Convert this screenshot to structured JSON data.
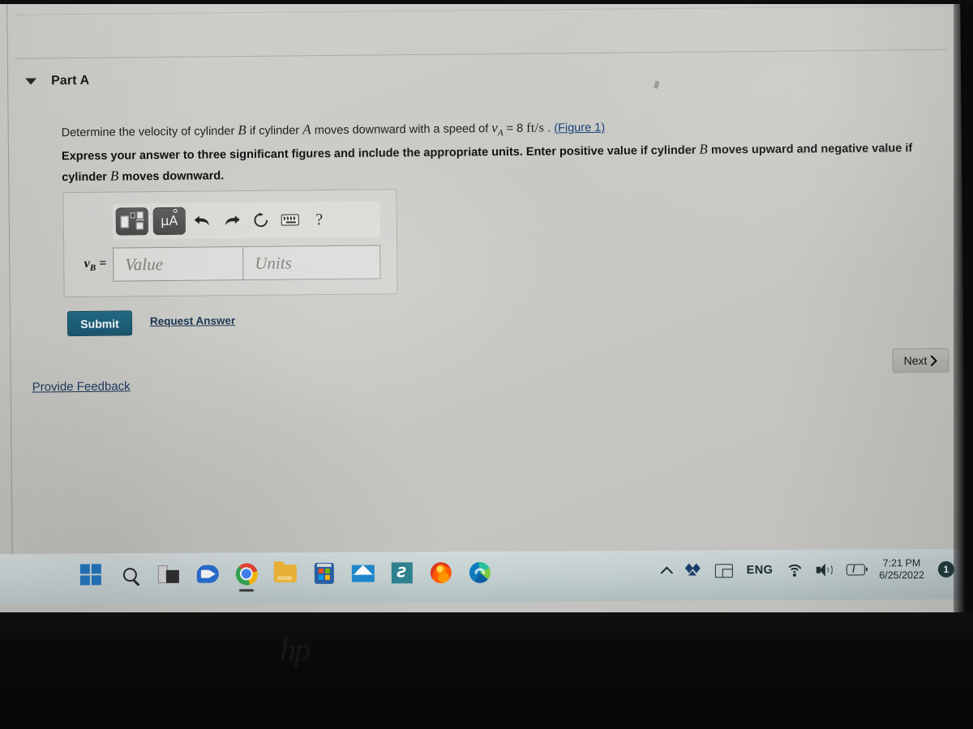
{
  "part": {
    "toggle_icon": "caret-down-icon",
    "title": "Part A"
  },
  "question": {
    "line1_a": "Determine the velocity of cylinder ",
    "line1_b": "B",
    "line1_c": " if cylinder ",
    "line1_d": "A",
    "line1_e": " moves downward with a speed of ",
    "line1_var": "v",
    "line1_sub": "A",
    "line1_eq": " = 8",
    "line1_units": "ft/s",
    "line1_period": ".",
    "figure_link": "(Figure 1)",
    "line2_a": "Express your answer to three significant figures and include the appropriate units. Enter positive value if cylinder ",
    "line2_b": "B",
    "line2_c": " moves upward and negative value if cylinder ",
    "line2_d": "B",
    "line2_e": " moves downward."
  },
  "answer_widget": {
    "toolbar": [
      {
        "name": "math-template-button",
        "label": "template"
      },
      {
        "name": "units-button",
        "label": "μA"
      },
      {
        "name": "undo-button",
        "label": "undo"
      },
      {
        "name": "redo-button",
        "label": "redo"
      },
      {
        "name": "reset-button",
        "label": "reset"
      },
      {
        "name": "keyboard-button",
        "label": "keyboard"
      },
      {
        "name": "help-button",
        "label": "?"
      }
    ],
    "help_glyph": "?",
    "unit_glyph": "μA",
    "variable": "v",
    "variable_sub": "B",
    "equals": "=",
    "value_placeholder": "Value",
    "units_placeholder": "Units",
    "value": "",
    "units": ""
  },
  "actions": {
    "submit_label": "Submit",
    "request_answer_label": "Request Answer",
    "next_label": "Next",
    "next_chevron": "›",
    "feedback_label": "Provide Feedback"
  },
  "colors": {
    "submit_bg": "#1b5670",
    "link": "#16324f",
    "figure_link": "#16417a",
    "page_bg": "#c7c7c3",
    "taskbar_bg": "#c6d2d3"
  },
  "taskbar": {
    "icons": [
      {
        "name": "start-button",
        "label": "Start"
      },
      {
        "name": "search-icon",
        "label": "Search"
      },
      {
        "name": "task-view-icon",
        "label": "Task View"
      },
      {
        "name": "meet-icon",
        "label": "Meet"
      },
      {
        "name": "chrome-icon",
        "label": "Google Chrome"
      },
      {
        "name": "file-explorer-icon",
        "label": "File Explorer"
      },
      {
        "name": "microsoft-store-icon",
        "label": "Microsoft Store"
      },
      {
        "name": "mail-icon",
        "label": "Mail"
      },
      {
        "name": "s-app-icon",
        "label": "S"
      },
      {
        "name": "firefox-icon",
        "label": "Firefox"
      },
      {
        "name": "edge-icon",
        "label": "Microsoft Edge"
      }
    ],
    "s_app_glyph": "Ƨ",
    "tray": {
      "overflow_icon": "chevron-up-icon",
      "dropbox_icon": "dropbox-icon",
      "touchpad_icon": "touchpad-icon",
      "language": "ENG",
      "wifi_icon": "wifi-icon",
      "volume_icon": "speaker-icon",
      "battery_icon": "battery-icon",
      "battery_bolt": "⚡",
      "time": "7:21 PM",
      "date": "6/25/2022",
      "notification_count": "1"
    }
  },
  "device": {
    "brand": "hp"
  }
}
